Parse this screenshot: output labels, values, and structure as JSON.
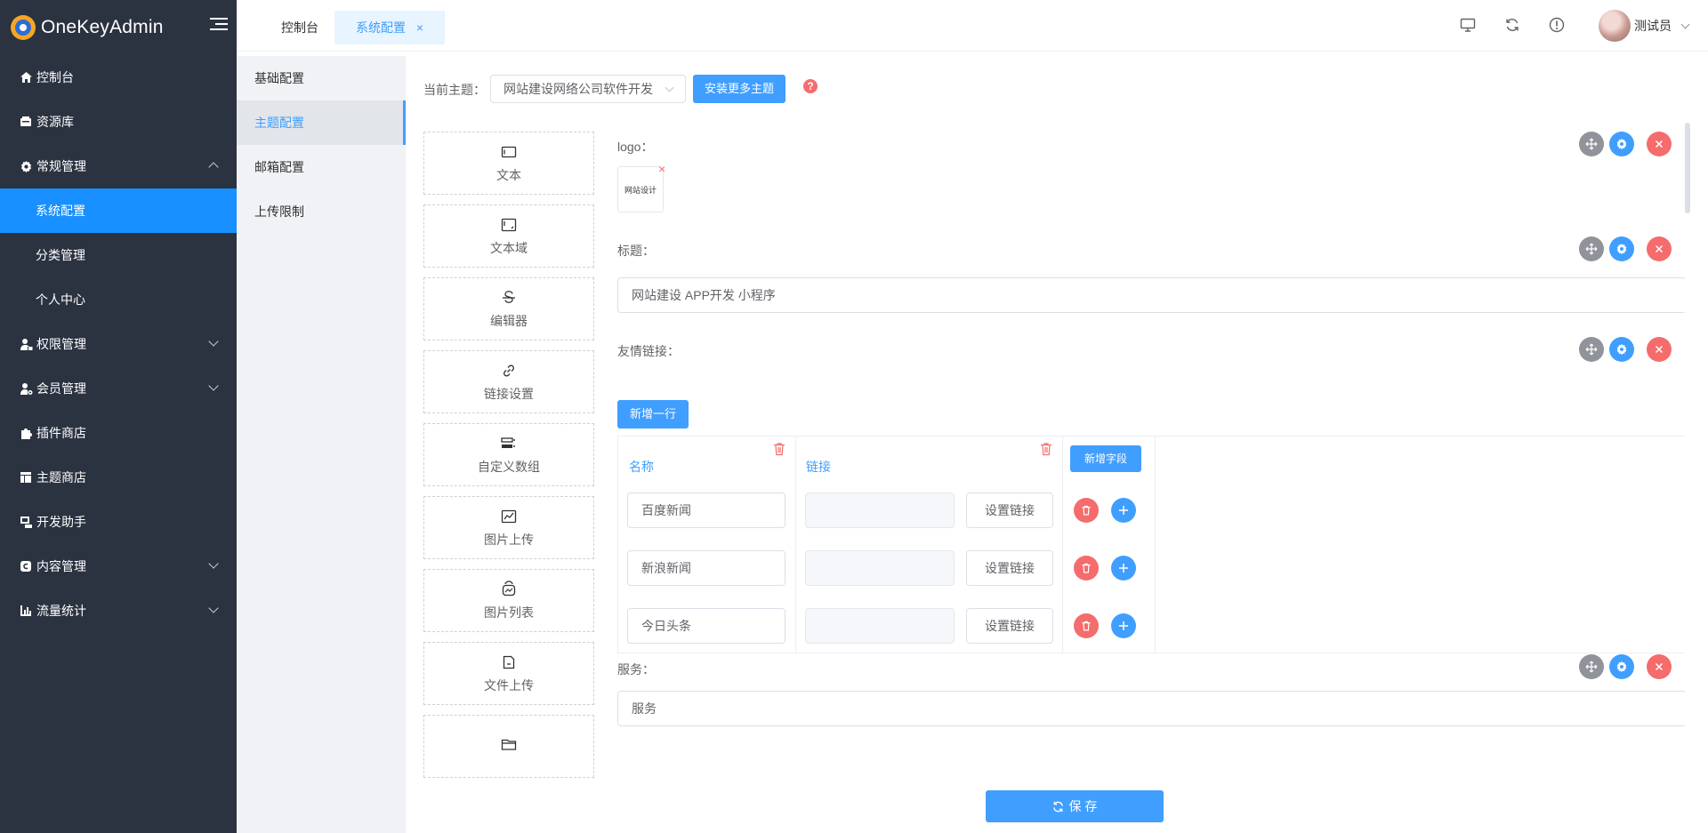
{
  "app": {
    "name": "OneKeyAdmin"
  },
  "sidebar": {
    "items": [
      {
        "label": "控制台",
        "icon": "home-icon"
      },
      {
        "label": "资源库",
        "icon": "database-icon"
      },
      {
        "label": "常规管理",
        "icon": "gear-icon",
        "expanded": true,
        "children": [
          {
            "label": "系统配置",
            "active": true
          },
          {
            "label": "分类管理"
          },
          {
            "label": "个人中心"
          }
        ]
      },
      {
        "label": "权限管理",
        "icon": "user-lock-icon",
        "expanded": false
      },
      {
        "label": "会员管理",
        "icon": "user-gear-icon",
        "expanded": false
      },
      {
        "label": "插件商店",
        "icon": "puzzle-icon"
      },
      {
        "label": "主题商店",
        "icon": "layout-icon"
      },
      {
        "label": "开发助手",
        "icon": "code-icon"
      },
      {
        "label": "内容管理",
        "icon": "content-icon",
        "expanded": false
      },
      {
        "label": "流量统计",
        "icon": "chart-icon",
        "expanded": false
      }
    ]
  },
  "tabs": [
    {
      "label": "控制台"
    },
    {
      "label": "系统配置",
      "active": true,
      "close": "×"
    }
  ],
  "user": {
    "name": "测试员"
  },
  "subnav": [
    {
      "label": "基础配置"
    },
    {
      "label": "主题配置",
      "active": true
    },
    {
      "label": "邮箱配置"
    },
    {
      "label": "上传限制"
    }
  ],
  "theme": {
    "label": "当前主题：",
    "selected": "网站建设网络公司软件开发",
    "install_button": "安装更多主题",
    "help": "?"
  },
  "palette": [
    {
      "label": "文本",
      "icon": "text-icon"
    },
    {
      "label": "文本域",
      "icon": "textarea-icon"
    },
    {
      "label": "编辑器",
      "icon": "editor-icon"
    },
    {
      "label": "链接设置",
      "icon": "link-icon"
    },
    {
      "label": "自定义数组",
      "icon": "array-icon"
    },
    {
      "label": "图片上传",
      "icon": "image-upload-icon"
    },
    {
      "label": "图片列表",
      "icon": "image-list-icon"
    },
    {
      "label": "文件上传",
      "icon": "file-upload-icon"
    },
    {
      "label": "",
      "icon": "folder-icon"
    }
  ],
  "fields": {
    "logo": {
      "label": "logo：",
      "image_text": "网站设计",
      "remove": "×"
    },
    "title": {
      "label": "标题：",
      "value": "网站建设 APP开发 小程序"
    },
    "links": {
      "label": "友情链接：",
      "add_row": "新增一行",
      "columns": [
        "名称",
        "链接"
      ],
      "add_field": "新增字段",
      "set_link": "设置链接",
      "rows": [
        {
          "name": "百度新闻",
          "link": ""
        },
        {
          "name": "新浪新闻",
          "link": ""
        },
        {
          "name": "今日头条",
          "link": ""
        }
      ]
    },
    "service": {
      "label": "服务：",
      "value": "服务"
    }
  },
  "save_button": "保 存"
}
